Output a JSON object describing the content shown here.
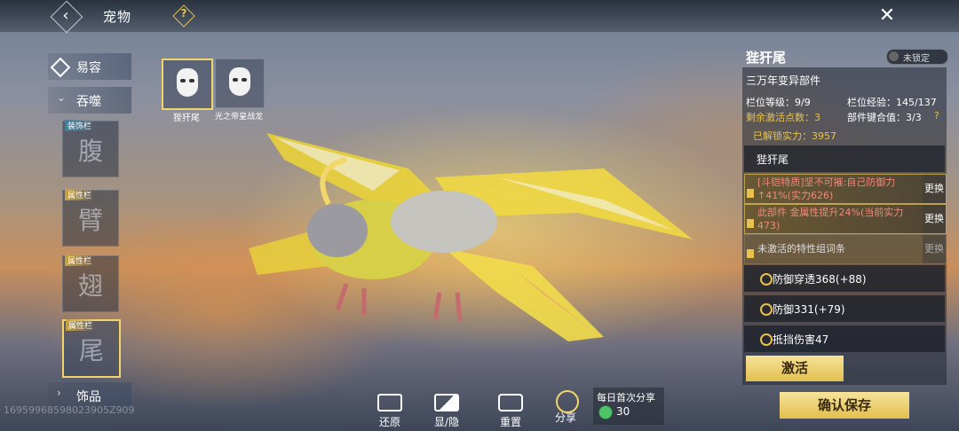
{
  "header": {
    "title": "宠物",
    "help_icon": "help-diamond-icon",
    "close_icon": "close-icon"
  },
  "nav": {
    "items": [
      {
        "label": "易容",
        "icon": "diamond-icon"
      },
      {
        "label": "吞噬",
        "icon": "chevron-down-icon"
      },
      {
        "label": "饰品",
        "icon": "chevron-right-icon"
      }
    ]
  },
  "slots": [
    {
      "tag": "装饰栏",
      "char": "腹"
    },
    {
      "tag": "属性栏",
      "char": "臂"
    },
    {
      "tag": "属性栏",
      "char": "翅"
    },
    {
      "tag": "属性栏",
      "char": "尾"
    }
  ],
  "pets": [
    {
      "name": "狴犴尾"
    },
    {
      "name": "光之帝皇战龙"
    }
  ],
  "toolbar": {
    "restore": "还原",
    "toggle": "显/隐",
    "reset": "重置",
    "share": "分享",
    "daily_share_title": "每日首次分享",
    "daily_share_value": "30"
  },
  "id_text": "16959968598023905Z909",
  "panel": {
    "name": "狴犴尾",
    "lock_label": "未锁定",
    "component_title": "三万年变异部件",
    "level_label": "栏位等级：9/9",
    "exp_label": "栏位经验：145/137",
    "points_label": "剩余激活点数：3",
    "fit_label": "部件键合值：3/3",
    "unlocked_label": "已解锁实力：3957",
    "section_name": "狴犴尾",
    "attr1": "[斗铠特质]坚不可摧:自己防御力↑41%(实力626)",
    "attr2": "此部件 金属性提升24%(当前实力473)",
    "attr3": "未激活的特性组词条",
    "swap_label": "更换",
    "stats": [
      "防御穿透368(+88)",
      "防御331(+79)",
      "抵挡伤害47"
    ],
    "activate": "激活",
    "confirm": "确认保存"
  },
  "colors": {
    "accent_gold": "#e8c24c",
    "button_gold": "#f1d56a"
  }
}
